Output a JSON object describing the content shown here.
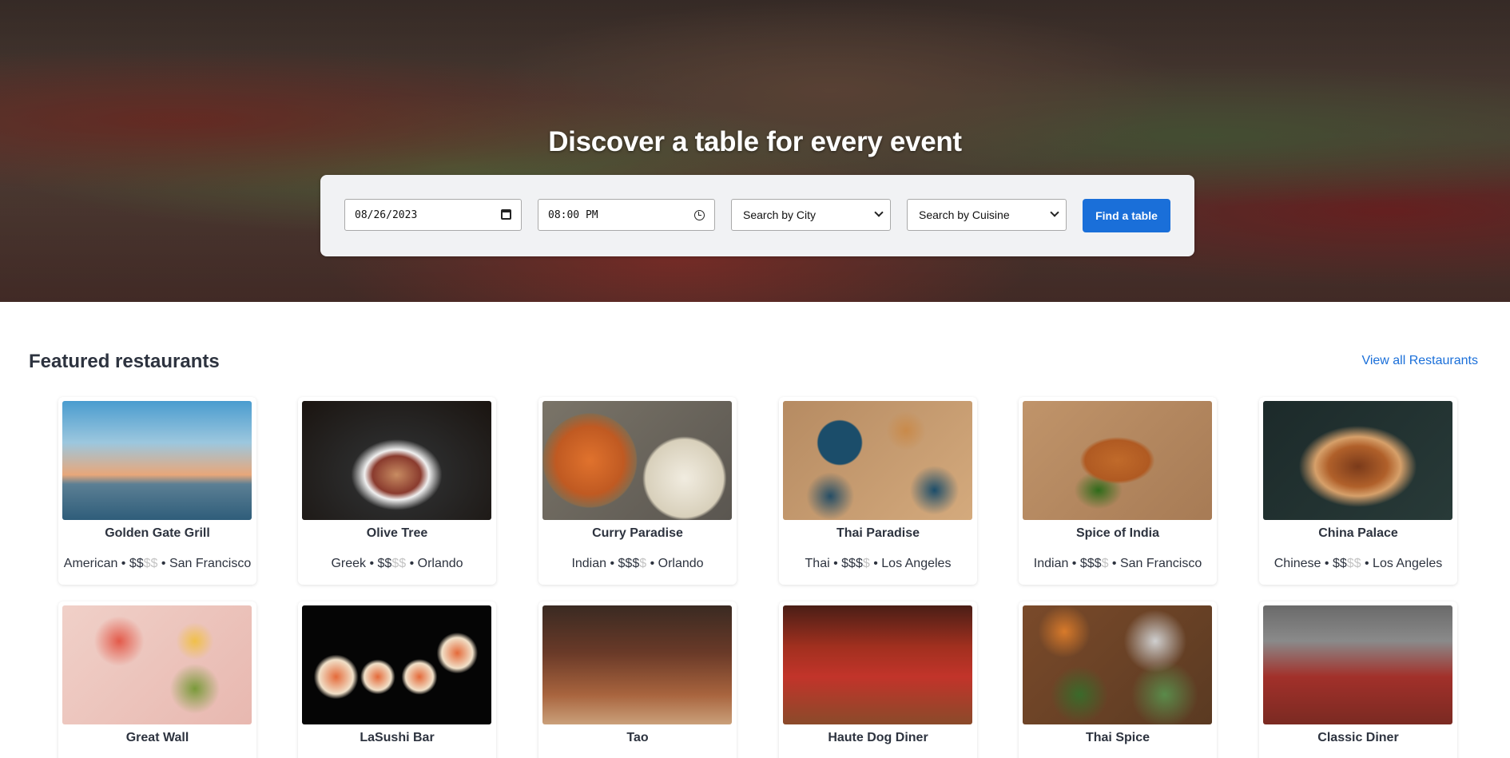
{
  "hero": {
    "title": "Discover a table for every event"
  },
  "search": {
    "date_value": "08/26/2023",
    "time_value": "08:00",
    "time_ampm": "PM",
    "city_placeholder": "Search by City",
    "cuisine_placeholder": "Search by Cuisine",
    "find_label": "Find a table"
  },
  "featured": {
    "title": "Featured restaurants",
    "view_all_label": "View all Restaurants"
  },
  "restaurants": [
    {
      "name": "Golden Gate Grill",
      "cuisine": "American",
      "price_active": "$$",
      "price_inactive": "$$",
      "city": "San Francisco"
    },
    {
      "name": "Olive Tree",
      "cuisine": "Greek",
      "price_active": "$$",
      "price_inactive": "$$",
      "city": "Orlando"
    },
    {
      "name": "Curry Paradise",
      "cuisine": "Indian",
      "price_active": "$$$",
      "price_inactive": "$",
      "city": "Orlando"
    },
    {
      "name": "Thai Paradise",
      "cuisine": "Thai",
      "price_active": "$$$",
      "price_inactive": "$",
      "city": "Los Angeles"
    },
    {
      "name": "Spice of India",
      "cuisine": "Indian",
      "price_active": "$$$",
      "price_inactive": "$",
      "city": "San Francisco"
    },
    {
      "name": "China Palace",
      "cuisine": "Chinese",
      "price_active": "$$",
      "price_inactive": "$$",
      "city": "Los Angeles"
    },
    {
      "name": "Great Wall"
    },
    {
      "name": "LaSushi Bar"
    },
    {
      "name": "Tao"
    },
    {
      "name": "Haute Dog Diner"
    },
    {
      "name": "Thai Spice"
    },
    {
      "name": "Classic Diner"
    }
  ],
  "colors": {
    "accent": "#1a6fd9",
    "text": "#2d333f",
    "price_inactive": "#c3c3c3",
    "panel": "#f1f2f4"
  },
  "icons": {
    "date": "calendar-icon",
    "time": "clock-icon",
    "select": "chevron-down-icon"
  }
}
